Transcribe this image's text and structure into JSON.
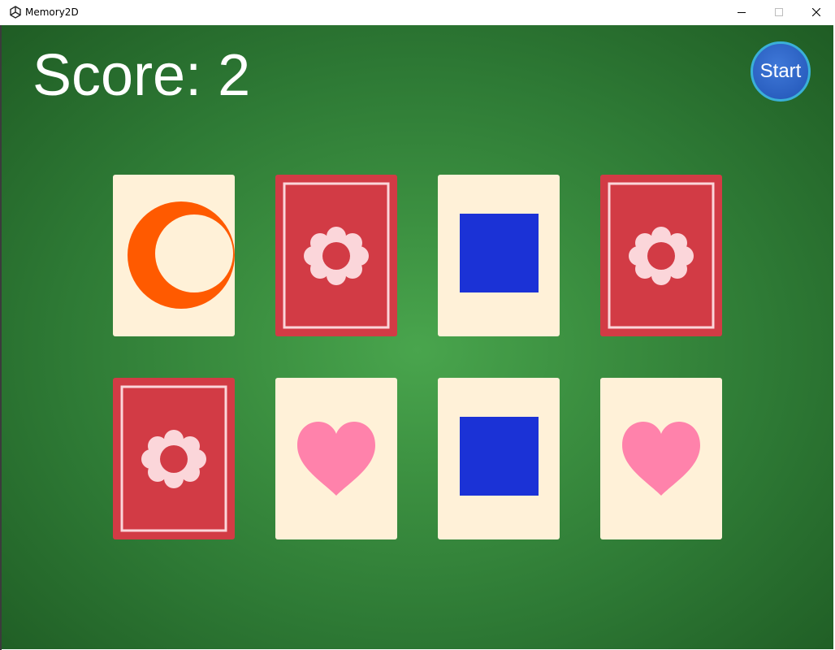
{
  "window": {
    "title": "Memory2D",
    "app_icon": "unity-icon"
  },
  "hud": {
    "score_text": "Score: 2",
    "start_label": "Start"
  },
  "colors": {
    "card_face": "#fff1d8",
    "card_back": "#d23b45",
    "card_back_ornament": "#fbd6da",
    "moon": "#ff5a00",
    "square": "#1b32d6",
    "heart": "#ff82ab",
    "table_green": "#3b8f40",
    "start_button": "#2a5fc0"
  },
  "cards": [
    {
      "state": "face-up",
      "symbol": "crescent-moon"
    },
    {
      "state": "face-down",
      "symbol": "flower-back"
    },
    {
      "state": "face-up",
      "symbol": "blue-square"
    },
    {
      "state": "face-down",
      "symbol": "flower-back"
    },
    {
      "state": "face-down",
      "symbol": "flower-back"
    },
    {
      "state": "face-up",
      "symbol": "heart"
    },
    {
      "state": "face-up",
      "symbol": "blue-square"
    },
    {
      "state": "face-up",
      "symbol": "heart"
    }
  ]
}
